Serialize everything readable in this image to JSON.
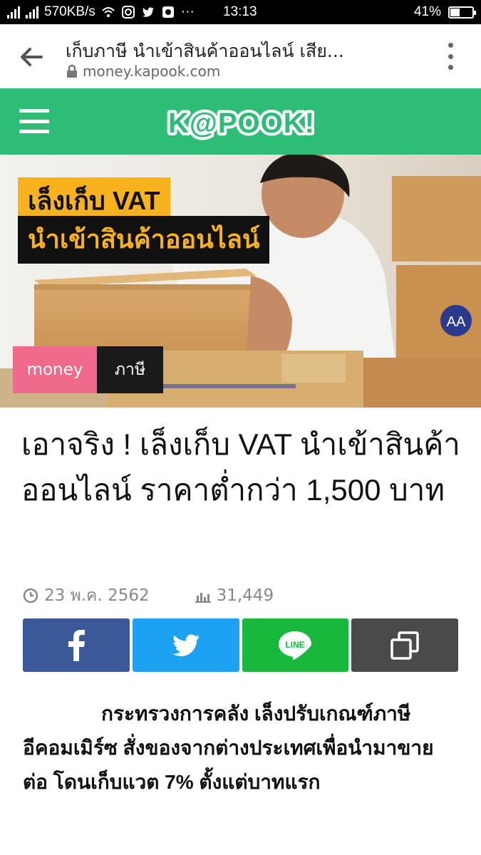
{
  "status_bar": {
    "network_speed": "570KB/s",
    "time": "13:13",
    "battery_percent": "41%",
    "battery_level": 0.41
  },
  "browser": {
    "page_title": "เก็บภาษี นำเข้าสินค้าออนไลน์ เสีย...",
    "url": "money.kapook.com"
  },
  "site": {
    "logo_text": "K@POOK!",
    "brand_color": "#2dbd77"
  },
  "hero": {
    "tag_line_1": "เล็งเก็บ VAT",
    "tag_line_2": "นำเข้าสินค้าออนไลน์",
    "box_label": "AA",
    "category_primary": "money",
    "category_secondary": "ภาษี"
  },
  "article": {
    "headline": "เอาจริง ! เล็งเก็บ VAT นำเข้าสินค้าออนไลน์ ราคาต่ำกว่า 1,500 บาท",
    "date": "23 พ.ค. 2562",
    "views": "31,449",
    "lead": "กระทรวงการคลัง เล็งปรับเกณฑ์ภาษีอีคอมเมิร์ซ สั่งของจากต่างประเทศเพื่อนำมาขายต่อ โดนเก็บแวต 7% ตั้งแต่บาทแรก"
  },
  "share": {
    "line_label": "LINE",
    "colors": {
      "facebook": "#3b5998",
      "twitter": "#1da1f2",
      "line": "#17b83b",
      "copy": "#4a4a4a"
    }
  }
}
